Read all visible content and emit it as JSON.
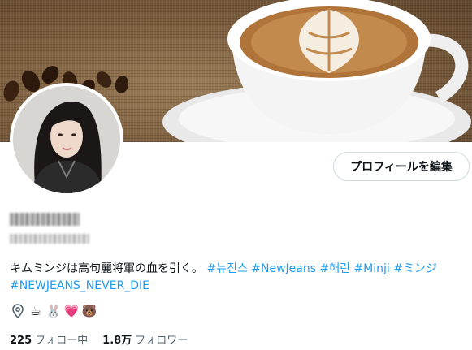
{
  "profile": {
    "edit_button_label": "プロフィールを編集",
    "bio_text": "キムミンジは高句麗将軍の血を引く。",
    "hashtags": [
      "#뉴진스",
      "#NewJeans",
      "#해린",
      "#Minji",
      "#ミンジ",
      "#NEWJEANS_NEVER_DIE"
    ],
    "location_icon": "map-pin-icon",
    "emojis": [
      "☕",
      "🐰",
      "💗",
      "🐻"
    ],
    "following_count": "225",
    "following_label": "フォロー中",
    "followers_count": "1.8万",
    "followers_label": "フォロワー"
  },
  "colors": {
    "link": "#1d9bf0",
    "text": "#0f1419",
    "secondary_text": "#536471",
    "button_border": "#cfd9de"
  }
}
